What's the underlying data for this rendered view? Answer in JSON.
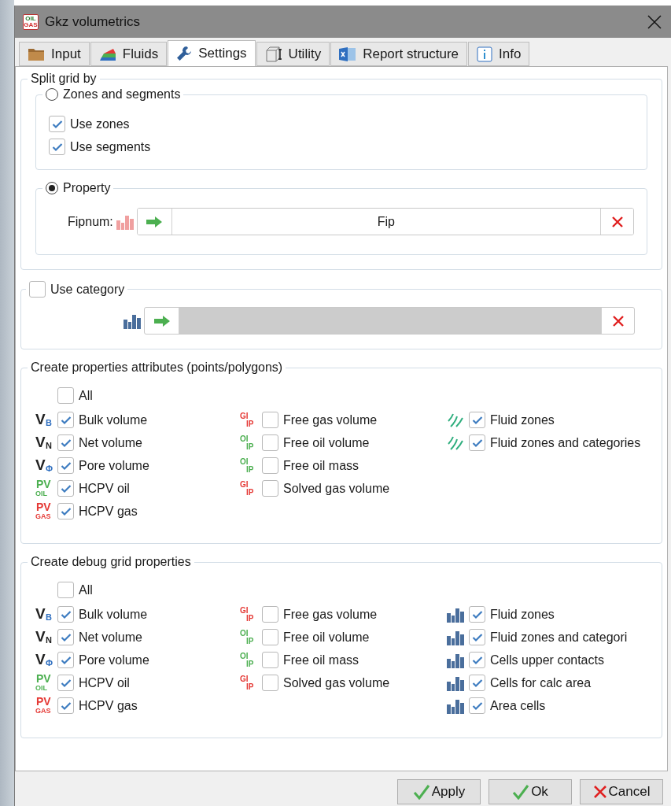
{
  "window": {
    "title": "Gkz volumetrics",
    "app_icon": {
      "top": "OIL",
      "bottom": "GAS"
    }
  },
  "tabs": [
    {
      "label": "Input",
      "kind": "folder",
      "selected": false
    },
    {
      "label": "Fluids",
      "kind": "layers",
      "selected": false
    },
    {
      "label": "Settings",
      "kind": "wrench",
      "selected": true
    },
    {
      "label": "Utility",
      "kind": "box",
      "selected": false
    },
    {
      "label": "Report structure",
      "kind": "sheet",
      "selected": false
    },
    {
      "label": "Info",
      "kind": "info",
      "selected": false
    }
  ],
  "split_grid": {
    "title": "Split grid by",
    "zones_and_segments": {
      "label": "Zones and segments",
      "selected": false,
      "options": [
        {
          "label": "Use zones",
          "checked": true
        },
        {
          "label": "Use segments",
          "checked": true
        }
      ]
    },
    "property": {
      "label": "Property",
      "selected": true,
      "field": {
        "label": "Fipnum:",
        "value": "Fip",
        "color": "#f0a0a0",
        "disabled": false
      }
    }
  },
  "category": {
    "label": "Use category",
    "checked": false,
    "field": {
      "color": "#4a6e9c",
      "disabled": true
    }
  },
  "attributes": {
    "title": "Create properties attributes (points/polygons)",
    "all": {
      "label": "All",
      "checked": false
    },
    "columns": [
      [
        {
          "label": "Bulk volume",
          "checked": true,
          "icon": {
            "kind": "sub",
            "main": "V",
            "sub": "B",
            "color": "#2f6fc0"
          }
        },
        {
          "label": "Net volume",
          "checked": true,
          "icon": {
            "kind": "sub",
            "main": "V",
            "sub": "N",
            "color": "#222222"
          }
        },
        {
          "label": "Pore volume",
          "checked": true,
          "icon": {
            "kind": "sub",
            "main": "V",
            "sub": "Φ",
            "color": "#2f6fc0"
          }
        },
        {
          "label": "HCPV oil",
          "checked": true,
          "icon": {
            "kind": "over",
            "main": "PV",
            "sub": "OIL",
            "color": "#4caf50"
          }
        },
        {
          "label": "HCPV gas",
          "checked": true,
          "icon": {
            "kind": "over",
            "main": "PV",
            "sub": "GAS",
            "color": "#e53935"
          }
        }
      ],
      [
        {
          "label": "Free gas volume",
          "checked": false,
          "icon": {
            "kind": "stack",
            "main": "GI",
            "sub": "IP",
            "color": "#e53935"
          }
        },
        {
          "label": "Free oil volume",
          "checked": false,
          "icon": {
            "kind": "stack",
            "main": "OI",
            "sub": "IP",
            "color": "#4caf50"
          }
        },
        {
          "label": "Free oil mass",
          "checked": false,
          "icon": {
            "kind": "stack",
            "main": "OI",
            "sub": "IP",
            "color": "#4caf50"
          }
        },
        {
          "label": "Solved gas volume",
          "checked": false,
          "icon": {
            "kind": "stack",
            "main": "GI",
            "sub": "IP",
            "color": "#e53935"
          }
        }
      ],
      [
        {
          "label": "Fluid zones",
          "checked": true,
          "icon": {
            "kind": "stripes"
          }
        },
        {
          "label": "Fluid zones and categories",
          "checked": true,
          "icon": {
            "kind": "stripes"
          }
        }
      ]
    ]
  },
  "debug": {
    "title": "Create debug grid properties",
    "all": {
      "label": "All",
      "checked": false
    },
    "columns": [
      [
        {
          "label": "Bulk volume",
          "checked": true,
          "icon": {
            "kind": "sub",
            "main": "V",
            "sub": "B",
            "color": "#2f6fc0"
          }
        },
        {
          "label": "Net volume",
          "checked": true,
          "icon": {
            "kind": "sub",
            "main": "V",
            "sub": "N",
            "color": "#222222"
          }
        },
        {
          "label": "Pore volume",
          "checked": true,
          "icon": {
            "kind": "sub",
            "main": "V",
            "sub": "Φ",
            "color": "#2f6fc0"
          }
        },
        {
          "label": "HCPV oil",
          "checked": true,
          "icon": {
            "kind": "over",
            "main": "PV",
            "sub": "OIL",
            "color": "#4caf50"
          }
        },
        {
          "label": "HCPV gas",
          "checked": true,
          "icon": {
            "kind": "over",
            "main": "PV",
            "sub": "GAS",
            "color": "#e53935"
          }
        }
      ],
      [
        {
          "label": "Free gas volume",
          "checked": false,
          "icon": {
            "kind": "stack",
            "main": "GI",
            "sub": "IP",
            "color": "#e53935"
          }
        },
        {
          "label": "Free oil volume",
          "checked": false,
          "icon": {
            "kind": "stack",
            "main": "OI",
            "sub": "IP",
            "color": "#4caf50"
          }
        },
        {
          "label": "Free oil mass",
          "checked": false,
          "icon": {
            "kind": "stack",
            "main": "OI",
            "sub": "IP",
            "color": "#4caf50"
          }
        },
        {
          "label": "Solved gas volume",
          "checked": false,
          "icon": {
            "kind": "stack",
            "main": "GI",
            "sub": "IP",
            "color": "#e53935"
          }
        }
      ],
      [
        {
          "label": "Fluid zones",
          "checked": true,
          "icon": {
            "kind": "bars"
          }
        },
        {
          "label": "Fluid zones and categori",
          "checked": true,
          "icon": {
            "kind": "bars"
          }
        },
        {
          "label": "Cells upper contacts",
          "checked": true,
          "icon": {
            "kind": "bars"
          }
        },
        {
          "label": "Cells for calc area",
          "checked": true,
          "icon": {
            "kind": "bars"
          }
        },
        {
          "label": "Area cells",
          "checked": true,
          "icon": {
            "kind": "bars"
          }
        }
      ]
    ]
  },
  "buttons": [
    {
      "label": "Apply",
      "kind": "ok"
    },
    {
      "label": "Ok",
      "kind": "ok"
    },
    {
      "label": "Cancel",
      "kind": "cancel"
    }
  ]
}
